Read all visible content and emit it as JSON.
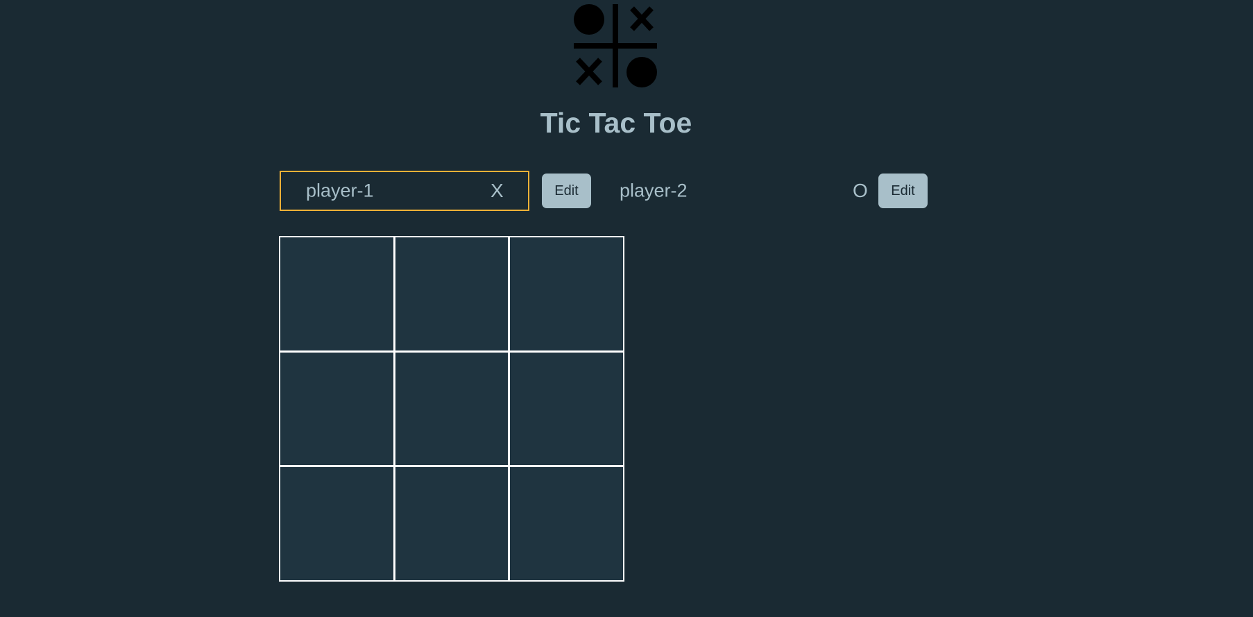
{
  "app": {
    "title": "Tic Tac Toe",
    "logo_icon": "tic-tac-toe-logo-icon"
  },
  "players": [
    {
      "name": "player-1",
      "symbol": "X",
      "edit_label": "Edit",
      "active": true
    },
    {
      "name": "player-2",
      "symbol": "O",
      "edit_label": "Edit",
      "active": false
    }
  ],
  "board": {
    "cells": [
      "",
      "",
      "",
      "",
      "",
      "",
      "",
      "",
      ""
    ]
  },
  "colors": {
    "background": "#1a2a33",
    "cell": "#1f3440",
    "text": "#a8bfc9",
    "active_border": "#f2b137",
    "grid_lines": "#ffffff"
  }
}
